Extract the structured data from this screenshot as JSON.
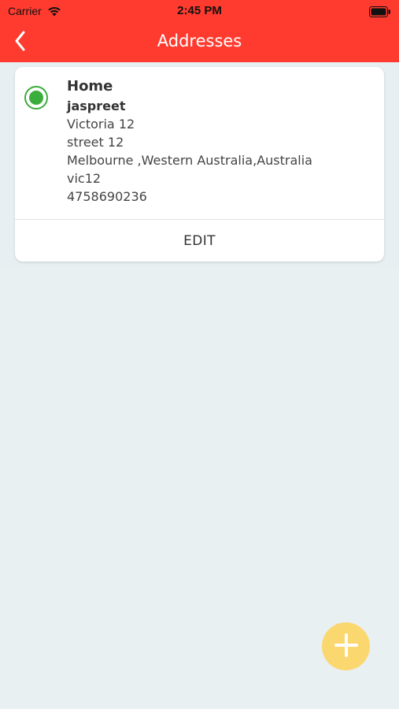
{
  "status_bar": {
    "carrier": "Carrier",
    "time": "2:45 PM"
  },
  "nav": {
    "title": "Addresses"
  },
  "addresses": [
    {
      "type": "Home",
      "name": "jaspreet",
      "line1": "Victoria 12",
      "line2": "street 12",
      "line3": "Melbourne ,Western Australia,Australia",
      "line4": "vic12",
      "phone": "4758690236",
      "selected": true,
      "edit_label": "EDIT"
    }
  ],
  "colors": {
    "brand_red": "#ff3b2f",
    "selected_green": "#3aad3c",
    "fab_yellow": "#fbd76f",
    "background": "#e9f0f2"
  },
  "icons": {
    "back": "chevron-left-icon",
    "wifi": "wifi-icon",
    "battery": "battery-icon",
    "add": "plus-icon"
  }
}
